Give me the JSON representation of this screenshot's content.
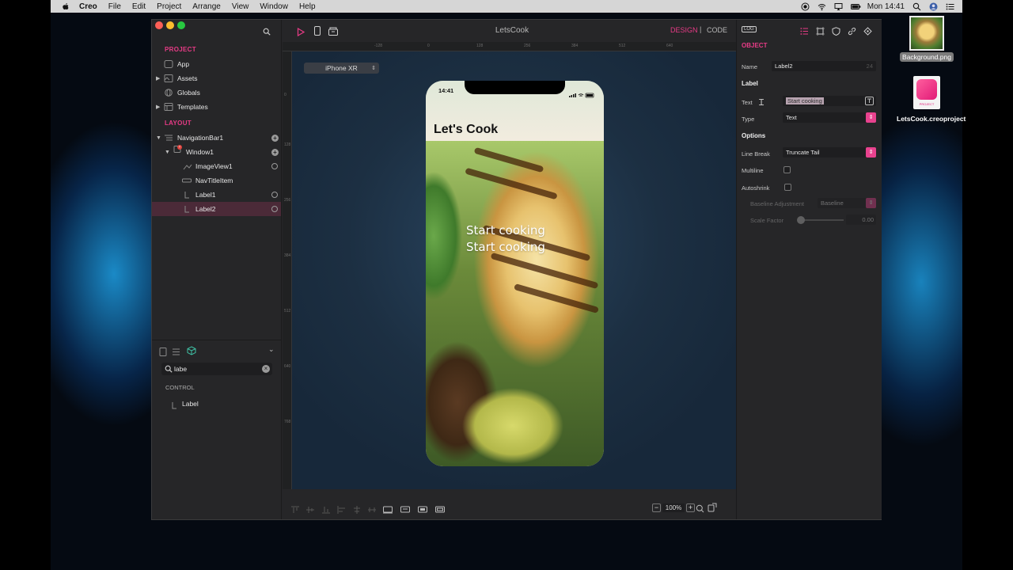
{
  "menubar": {
    "app_name": "Creo",
    "items": [
      "File",
      "Edit",
      "Project",
      "Arrange",
      "View",
      "Window",
      "Help"
    ],
    "clock": "Mon 14:41"
  },
  "desktop_icons": [
    {
      "label": "Background.png"
    },
    {
      "label": "LetsCook.creoproject",
      "badge": "PROJECT"
    }
  ],
  "window": {
    "title": "LetsCook",
    "mode_design": "DESIGN",
    "mode_separator": "|",
    "mode_code": "CODE"
  },
  "sidebar": {
    "project_header": "PROJECT",
    "project_items": [
      "App",
      "Assets",
      "Globals",
      "Templates"
    ],
    "layout_header": "LAYOUT",
    "layout_items": [
      "NavigationBar1",
      "Window1",
      "ImageView1",
      "NavTitleItem",
      "Label1",
      "Label2"
    ],
    "selected_item": "Label2"
  },
  "library": {
    "search_value": "labe",
    "section": "CONTROL",
    "result": "Label"
  },
  "canvas": {
    "device": "iPhone XR",
    "ruler_top": [
      "-128",
      "0",
      "128",
      "256",
      "384",
      "512",
      "640"
    ],
    "ruler_left": [
      "0",
      "128",
      "256",
      "384",
      "512",
      "640",
      "768"
    ],
    "zoom": "100%",
    "zoom_minus": "−",
    "zoom_plus": "+"
  },
  "phone": {
    "status_time": "14:41",
    "nav_title": "Let's Cook",
    "label1": "Start cooking",
    "label2": "Start cooking"
  },
  "inspector": {
    "object_header": "OBJECT",
    "log_badge": "LOG",
    "name_label": "Name",
    "name_value": "Label2",
    "name_count": "24",
    "label_section": "Label",
    "text_label": "Text",
    "text_value": "Start cooking",
    "type_label": "Type",
    "type_value": "Text",
    "options_section": "Options",
    "line_break_label": "Line Break",
    "line_break_value": "Truncate Tail",
    "multiline_label": "Multiline",
    "multiline_checked": false,
    "autoshrink_label": "Autoshrink",
    "autoshrink_checked": false,
    "baseline_label": "Baseline Adjustment",
    "baseline_value": "Baseline",
    "scale_label": "Scale Factor",
    "scale_value": "0.00"
  },
  "colors": {
    "accent": "#e83b86",
    "window_bg": "#262628",
    "selected_row": "#4b2a38"
  }
}
